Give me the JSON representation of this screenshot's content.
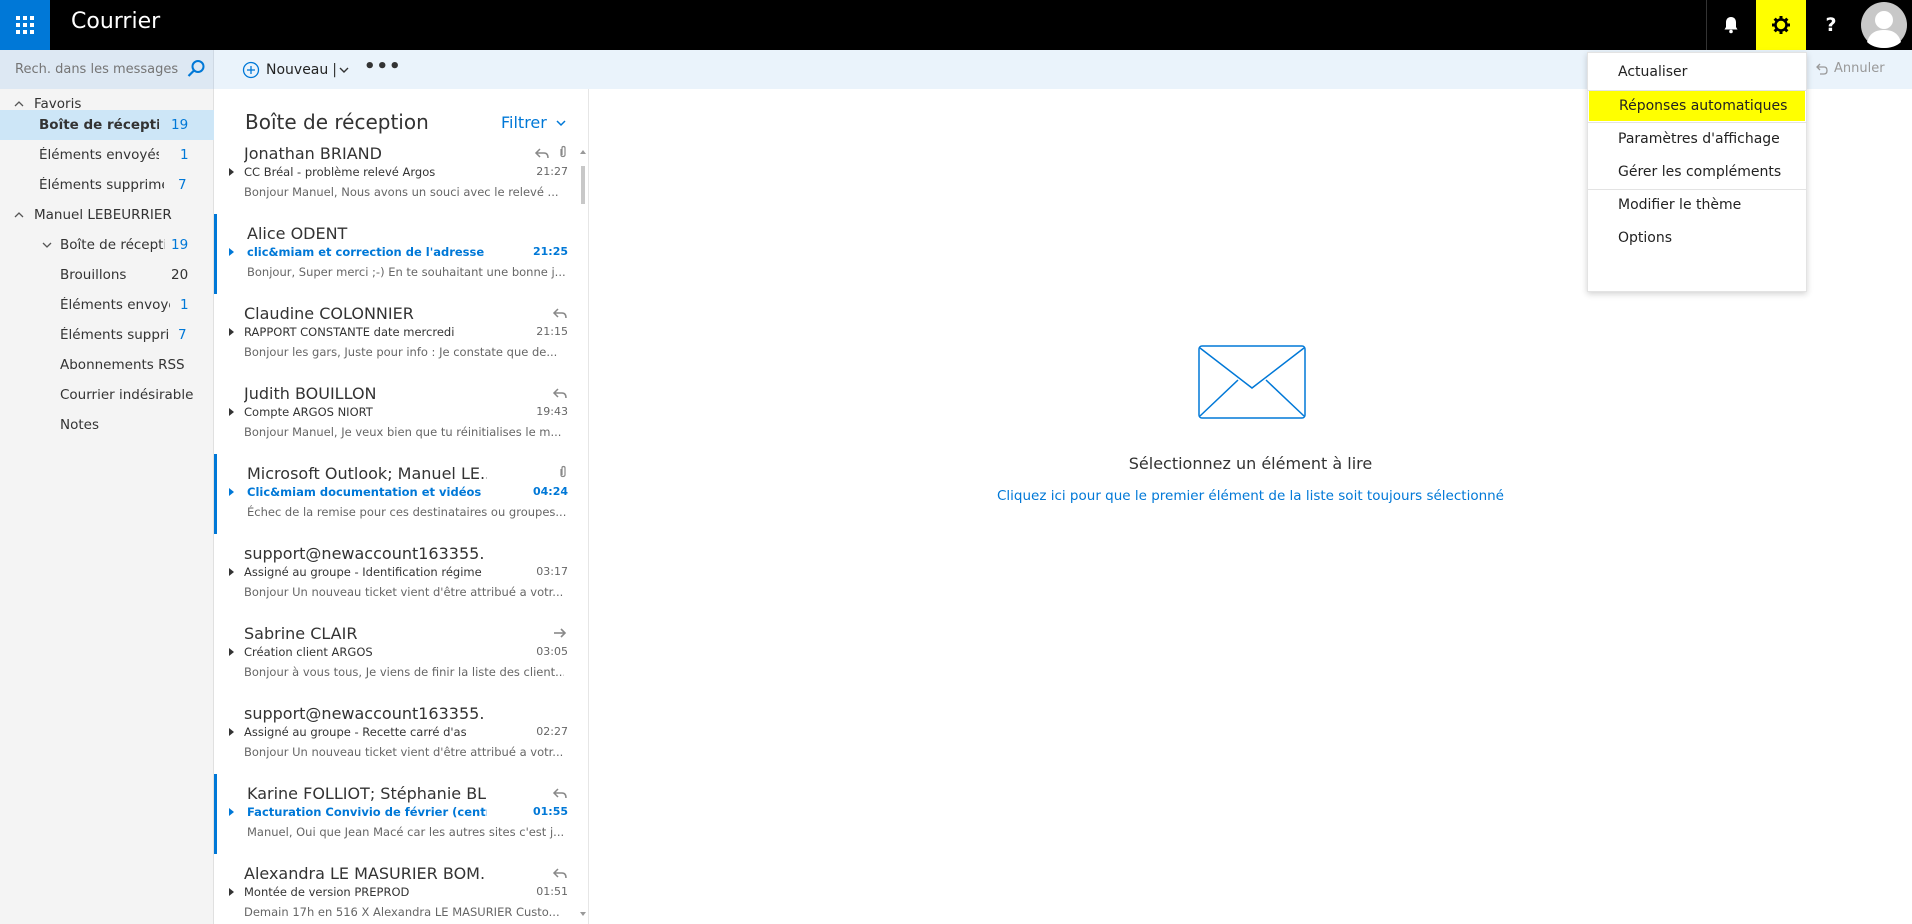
{
  "app": {
    "title": "Courrier"
  },
  "search": {
    "placeholder": "Rech. dans les messages e..."
  },
  "toolbar": {
    "new_label": "Nouveau",
    "more_label": "•••",
    "cancel_label": "Annuler"
  },
  "folders": [
    {
      "label": "Favoris",
      "count": ""
    },
    {
      "label": "Boîte de réception",
      "count": "19"
    },
    {
      "label": "Éléments envoyés",
      "count": "1"
    },
    {
      "label": "Éléments supprimés",
      "count": "7"
    },
    {
      "label": "Manuel LEBEURRIER",
      "count": ""
    },
    {
      "label": "Boîte de réceptio",
      "count": "19"
    },
    {
      "label": "Brouillons",
      "count": "20"
    },
    {
      "label": "Éléments envoyés",
      "count": "1"
    },
    {
      "label": "Éléments supprim",
      "count": "7"
    },
    {
      "label": "Abonnements RSS",
      "count": ""
    },
    {
      "label": "Courrier indésirable",
      "count": ""
    },
    {
      "label": "Notes",
      "count": ""
    }
  ],
  "list": {
    "title": "Boîte de réception",
    "filter_label": "Filtrer",
    "messages": [
      {
        "sender": "Jonathan BRIAND",
        "subject": "CC Bréal - problème relevé Argos",
        "time": "21:27",
        "preview": "Bonjour Manuel, Nous avons un souci avec le relevé ...",
        "unread": false,
        "icons": [
          "reply-icon",
          "attachment-icon"
        ]
      },
      {
        "sender": "Alice ODENT",
        "subject": "clic&miam et correction de l'adresse mail",
        "time": "21:25",
        "preview": "Bonjour, Super merci ;-) En te souhaitant une bonne j...",
        "unread": true,
        "icons": []
      },
      {
        "sender": "Claudine COLONNIER",
        "subject": "RAPPORT CONSTANTE date mercredi",
        "time": "21:15",
        "preview": "Bonjour les gars, Juste pour info : Je constate que de...",
        "unread": false,
        "icons": [
          "reply-icon"
        ]
      },
      {
        "sender": "Judith BOUILLON",
        "subject": "Compte ARGOS NIORT",
        "time": "19:43",
        "preview": "Bonjour Manuel, Je veux bien que tu réinitialises le m...",
        "unread": false,
        "icons": [
          "reply-icon"
        ]
      },
      {
        "sender": "Microsoft Outlook; Manuel LE...",
        "subject": "Clic&miam documentation et vidéos",
        "time": "04:24",
        "preview": "Échec de la remise pour ces destinataires ou groupes...",
        "unread": true,
        "icons": [
          "attachment-icon"
        ]
      },
      {
        "sender": "support@newaccount163355...",
        "subject": "Assigné au groupe - Identification régime sur",
        "time": "03:17",
        "preview": "Bonjour Un nouveau ticket vient d'être attribué a votr...",
        "unread": false,
        "icons": []
      },
      {
        "sender": "Sabrine CLAIR",
        "subject": "Création client ARGOS",
        "time": "03:05",
        "preview": "Bonjour à vous tous, Je viens de finir la liste des client...",
        "unread": false,
        "icons": [
          "forward-icon"
        ]
      },
      {
        "sender": "support@newaccount163355...",
        "subject": "Assigné au groupe - Recette carré d'as",
        "time": "02:27",
        "preview": "Bonjour Un nouveau ticket vient d'être attribué a votr...",
        "unread": false,
        "icons": []
      },
      {
        "sender": "Karine FOLLIOT; Stéphanie BL...",
        "subject": "Facturation Convivio de février (centre de lo",
        "time": "01:55",
        "preview": "Manuel, Oui que Jean Macé car les autres sites c'est j...",
        "unread": true,
        "icons": [
          "reply-icon"
        ]
      },
      {
        "sender": "Alexandra LE MASURIER BOM...",
        "subject": "Montée de version PREPROD",
        "time": "01:51",
        "preview": "Demain 17h en 516 X Alexandra LE MASURIER Custo...",
        "unread": false,
        "icons": [
          "reply-icon"
        ]
      }
    ]
  },
  "reading": {
    "title": "Sélectionnez un élément à lire",
    "link": "Cliquez ici pour que le premier élément de la liste soit toujours sélectionné"
  },
  "settings_menu": {
    "items": [
      {
        "label": "Actualiser"
      },
      {
        "label": "Réponses automatiques"
      },
      {
        "label": "Paramètres d'affichage"
      },
      {
        "label": "Gérer les compléments"
      },
      {
        "label": "Modifier le thème"
      },
      {
        "label": "Options"
      }
    ]
  },
  "colors": {
    "accent": "#0078d7",
    "highlight": "#ffff00",
    "topbar": "#000000"
  }
}
